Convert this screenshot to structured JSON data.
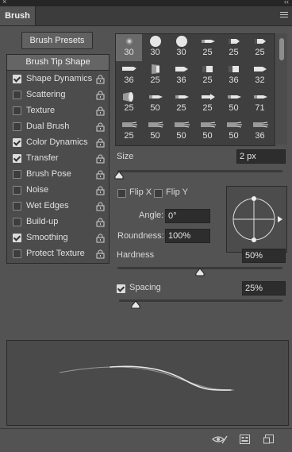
{
  "window": {
    "close": "×",
    "collapse": "‹‹"
  },
  "panel": {
    "tab_label": "Brush"
  },
  "presets_button": "Brush Presets",
  "sidebar": {
    "tip_shape_label": "Brush Tip Shape",
    "items": [
      {
        "label": "Shape Dynamics",
        "checked": true
      },
      {
        "label": "Scattering",
        "checked": false
      },
      {
        "label": "Texture",
        "checked": false
      },
      {
        "label": "Dual Brush",
        "checked": false
      },
      {
        "label": "Color Dynamics",
        "checked": true
      },
      {
        "label": "Transfer",
        "checked": true
      },
      {
        "label": "Brush Pose",
        "checked": false
      },
      {
        "label": "Noise",
        "checked": false
      },
      {
        "label": "Wet Edges",
        "checked": false
      },
      {
        "label": "Build-up",
        "checked": false
      },
      {
        "label": "Smoothing",
        "checked": true
      },
      {
        "label": "Protect Texture",
        "checked": false
      }
    ]
  },
  "brush_grid": {
    "rows": [
      [
        {
          "size": "30",
          "shape": "soft-round"
        },
        {
          "size": "30",
          "shape": "hard-round"
        },
        {
          "size": "30",
          "shape": "hard-round"
        },
        {
          "size": "25",
          "shape": "pencil"
        },
        {
          "size": "25",
          "shape": "tip"
        },
        {
          "size": "25",
          "shape": "tip"
        }
      ],
      [
        {
          "size": "36",
          "shape": "flat"
        },
        {
          "size": "25",
          "shape": "fan"
        },
        {
          "size": "36",
          "shape": "bullet"
        },
        {
          "size": "25",
          "shape": "box"
        },
        {
          "size": "36",
          "shape": "box"
        },
        {
          "size": "32",
          "shape": "bullet"
        }
      ],
      [
        {
          "size": "25",
          "shape": "cone"
        },
        {
          "size": "50",
          "shape": "pencil"
        },
        {
          "size": "25",
          "shape": "pencil"
        },
        {
          "size": "25",
          "shape": "arrow"
        },
        {
          "size": "50",
          "shape": "pencil"
        },
        {
          "size": "71",
          "shape": "pencil"
        }
      ],
      [
        {
          "size": "25",
          "shape": "bristle"
        },
        {
          "size": "50",
          "shape": "bristle"
        },
        {
          "size": "50",
          "shape": "bristle"
        },
        {
          "size": "50",
          "shape": "bristle"
        },
        {
          "size": "50",
          "shape": "bristle"
        },
        {
          "size": "36",
          "shape": "bristle"
        }
      ]
    ]
  },
  "size": {
    "label": "Size",
    "value": "2 px",
    "level": 0.01
  },
  "flip_x": {
    "label": "Flip X",
    "checked": false
  },
  "flip_y": {
    "label": "Flip Y",
    "checked": false
  },
  "angle": {
    "label": "Angle:",
    "value": "0°"
  },
  "roundness": {
    "label": "Roundness:",
    "value": "100%"
  },
  "hardness": {
    "label": "Hardness",
    "value": "50%",
    "level": 0.5
  },
  "spacing": {
    "label": "Spacing",
    "value": "25%",
    "checked": true,
    "level": 0.1
  },
  "bottom_icons": [
    "eye-brush-icon",
    "grid-icon",
    "new-preset-icon"
  ],
  "colors": {
    "panel_bg": "#535353",
    "field_bg": "#2d2d2d",
    "selected_cell": "#6a6a6a"
  }
}
